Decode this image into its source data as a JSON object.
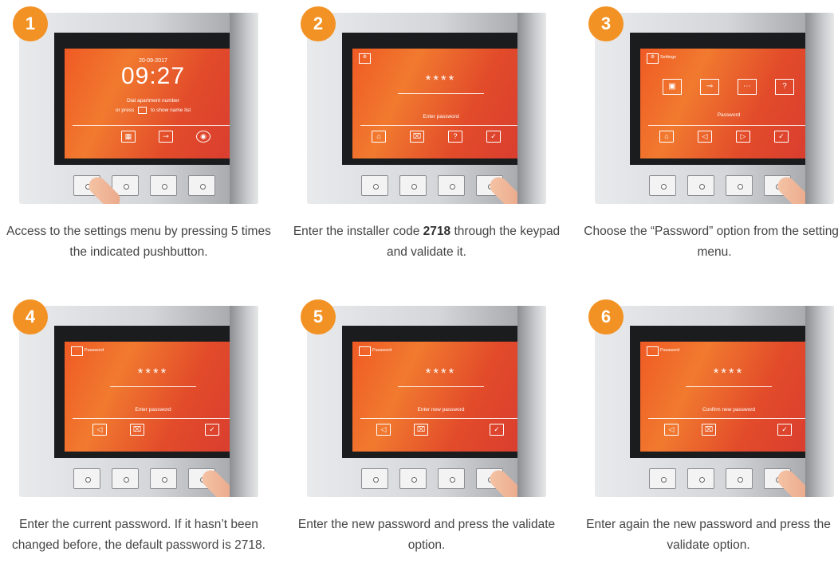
{
  "steps": [
    {
      "number": "1",
      "screen": {
        "date": "20-09-2017",
        "time": "09:27",
        "line1": "Dial apartment number",
        "line2_pre": "or press",
        "line2_post": "to show name list"
      },
      "caption": "Access to the settings menu by pressing 5 times the indicated pushbutton."
    },
    {
      "number": "2",
      "screen": {
        "masked": "****",
        "prompt": "Enter password"
      },
      "caption_pre": "Enter the installer code",
      "caption_bold": "2718",
      "caption_post": "through the keypad and validate it."
    },
    {
      "number": "3",
      "screen": {
        "title": "Settings",
        "selected_label": "Password"
      },
      "caption": "Choose the “Password” option from the settings menu."
    },
    {
      "number": "4",
      "screen": {
        "title": "Password",
        "masked": "****",
        "prompt": "Enter password"
      },
      "caption": "Enter the current password. If it hasn’t been changed before, the default password is 2718."
    },
    {
      "number": "5",
      "screen": {
        "title": "Password",
        "masked": "****",
        "prompt": "Enter new password"
      },
      "caption": "Enter the new password and press the validate option."
    },
    {
      "number": "6",
      "screen": {
        "title": "Password",
        "masked": "****",
        "prompt": "Confirm new password"
      },
      "caption": "Enter again the new password and press the validate option."
    }
  ],
  "icons": {
    "step1_softkeys": [
      "name-list-icon",
      "key-icon",
      "globe-icon"
    ],
    "step2_softkeys": [
      "home-icon",
      "delete-icon",
      "help-icon",
      "check-icon"
    ],
    "step3_menu": [
      "monitor-icon",
      "key-icon",
      "password-icon",
      "help-icon"
    ],
    "step3_softkeys": [
      "home-icon",
      "left-arrow-icon",
      "right-arrow-icon",
      "check-icon"
    ],
    "password_softkeys": [
      "left-arrow-icon",
      "delete-icon",
      "check-icon"
    ]
  },
  "colors": {
    "badge": "#f39224",
    "screen": "#ef5a24",
    "text": "#444444"
  }
}
